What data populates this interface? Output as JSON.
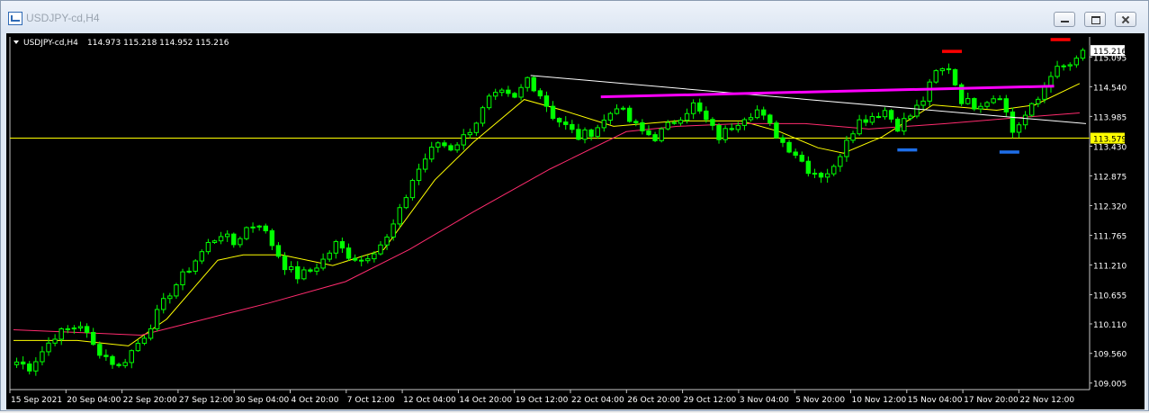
{
  "window": {
    "title": "USDJPY-cd,H4"
  },
  "chart_data": {
    "type": "candlestick",
    "symbol_info": "USDJPY-cd,H4",
    "ohlc_header": "114.973 115.218 114.952 115.216",
    "x_ticks": [
      "15 Sep 2021",
      "20 Sep 04:00",
      "22 Sep 20:00",
      "27 Sep 12:00",
      "30 Sep 04:00",
      "4 Oct 20:00",
      "7 Oct 12:00",
      "12 Oct 04:00",
      "14 Oct 20:00",
      "19 Oct 12:00",
      "22 Oct 04:00",
      "26 Oct 20:00",
      "29 Oct 12:00",
      "3 Nov 04:00",
      "5 Nov 20:00",
      "10 Nov 12:00",
      "15 Nov 04:00",
      "17 Nov 20:00",
      "22 Nov 12:00"
    ],
    "y_ticks": [
      "115.095",
      "114.540",
      "113.985",
      "113.430",
      "112.875",
      "112.320",
      "111.765",
      "111.210",
      "110.655",
      "110.110",
      "109.560",
      "109.005"
    ],
    "ylim": [
      108.95,
      115.42
    ],
    "current_price_label": "115.216",
    "hline_label": "113.579",
    "hline_price": 113.579,
    "close_path": [
      [
        0,
        109.4
      ],
      [
        2,
        109.3
      ],
      [
        4,
        109.6
      ],
      [
        6,
        109.9
      ],
      [
        8,
        110.0
      ],
      [
        10,
        110.1
      ],
      [
        12,
        109.7
      ],
      [
        14,
        109.5
      ],
      [
        16,
        109.3
      ],
      [
        18,
        109.6
      ],
      [
        20,
        109.9
      ],
      [
        22,
        110.3
      ],
      [
        24,
        110.7
      ],
      [
        26,
        111.0
      ],
      [
        28,
        111.3
      ],
      [
        30,
        111.6
      ],
      [
        32,
        111.8
      ],
      [
        34,
        111.6
      ],
      [
        36,
        111.9
      ],
      [
        38,
        112.0
      ],
      [
        40,
        111.6
      ],
      [
        42,
        111.2
      ],
      [
        44,
        111.0
      ],
      [
        46,
        111.1
      ],
      [
        48,
        111.3
      ],
      [
        50,
        111.6
      ],
      [
        52,
        111.4
      ],
      [
        54,
        111.3
      ],
      [
        56,
        111.5
      ],
      [
        58,
        111.7
      ],
      [
        60,
        112.2
      ],
      [
        62,
        112.8
      ],
      [
        64,
        113.2
      ],
      [
        66,
        113.5
      ],
      [
        68,
        113.4
      ],
      [
        70,
        113.6
      ],
      [
        72,
        113.9
      ],
      [
        74,
        114.3
      ],
      [
        76,
        114.4
      ],
      [
        78,
        114.3
      ],
      [
        80,
        114.7
      ],
      [
        82,
        114.4
      ],
      [
        84,
        114.0
      ],
      [
        86,
        113.8
      ],
      [
        88,
        113.6
      ],
      [
        90,
        113.7
      ],
      [
        92,
        113.9
      ],
      [
        94,
        114.2
      ],
      [
        96,
        113.9
      ],
      [
        98,
        113.7
      ],
      [
        100,
        113.6
      ],
      [
        102,
        113.8
      ],
      [
        104,
        114.0
      ],
      [
        106,
        114.2
      ],
      [
        108,
        113.9
      ],
      [
        110,
        113.6
      ],
      [
        112,
        113.8
      ],
      [
        114,
        114.0
      ],
      [
        116,
        114.1
      ],
      [
        118,
        113.8
      ],
      [
        120,
        113.5
      ],
      [
        122,
        113.3
      ],
      [
        124,
        113.0
      ],
      [
        126,
        112.9
      ],
      [
        128,
        113.0
      ],
      [
        130,
        113.6
      ],
      [
        132,
        113.9
      ],
      [
        134,
        114.0
      ],
      [
        136,
        114.1
      ],
      [
        138,
        113.8
      ],
      [
        140,
        114.0
      ],
      [
        142,
        114.3
      ],
      [
        144,
        114.8
      ],
      [
        146,
        114.9
      ],
      [
        148,
        114.3
      ],
      [
        150,
        114.2
      ],
      [
        152,
        114.3
      ],
      [
        154,
        114.4
      ],
      [
        156,
        113.7
      ],
      [
        158,
        114.0
      ],
      [
        160,
        114.3
      ],
      [
        162,
        114.8
      ],
      [
        164,
        114.9
      ],
      [
        166,
        115.0
      ],
      [
        167,
        115.22
      ]
    ],
    "series": [
      {
        "name": "",
        "color": "#ffff00",
        "points": [
          [
            0,
            109.8
          ],
          [
            10,
            109.8
          ],
          [
            18,
            109.7
          ],
          [
            24,
            110.2
          ],
          [
            32,
            111.3
          ],
          [
            36,
            111.4
          ],
          [
            42,
            111.4
          ],
          [
            50,
            111.2
          ],
          [
            58,
            111.5
          ],
          [
            66,
            112.8
          ],
          [
            72,
            113.5
          ],
          [
            80,
            114.3
          ],
          [
            86,
            114.1
          ],
          [
            94,
            113.8
          ],
          [
            104,
            113.9
          ],
          [
            114,
            113.9
          ],
          [
            120,
            113.7
          ],
          [
            126,
            113.4
          ],
          [
            130,
            113.3
          ],
          [
            136,
            113.6
          ],
          [
            144,
            114.2
          ],
          [
            154,
            114.1
          ],
          [
            160,
            114.2
          ],
          [
            167,
            114.6
          ]
        ]
      },
      {
        "name": "",
        "color": "#ff2b6e",
        "points": [
          [
            0,
            110.0
          ],
          [
            20,
            109.9
          ],
          [
            30,
            110.2
          ],
          [
            40,
            110.5
          ],
          [
            52,
            110.9
          ],
          [
            62,
            111.5
          ],
          [
            72,
            112.2
          ],
          [
            84,
            113.0
          ],
          [
            96,
            113.7
          ],
          [
            104,
            113.8
          ],
          [
            114,
            113.85
          ],
          [
            124,
            113.85
          ],
          [
            134,
            113.75
          ],
          [
            146,
            113.85
          ],
          [
            156,
            113.95
          ],
          [
            167,
            114.05
          ]
        ]
      }
    ],
    "trendlines": [
      {
        "color": "#ffffff",
        "from": [
          81,
          114.75
        ],
        "to": [
          168,
          113.85
        ]
      },
      {
        "color": "#ff00ff",
        "from": [
          92,
          114.35
        ],
        "to": [
          163,
          114.55
        ]
      },
      {
        "color": "#ffffff",
        "from": [
          0,
          113.579
        ],
        "to": [
          168,
          113.579
        ]
      }
    ],
    "markers": [
      {
        "color": "#ff0000",
        "x": 147,
        "price": 115.2
      },
      {
        "color": "#ff0000",
        "x": 164,
        "price": 115.42
      },
      {
        "color": "#1e6ee8",
        "x": 140,
        "price": 113.36
      },
      {
        "color": "#1e6ee8",
        "x": 156,
        "price": 113.32
      }
    ],
    "grid": false,
    "colors": {
      "background": "#000000",
      "candle": "#00ff00",
      "axis_text": "#ffffff"
    }
  }
}
